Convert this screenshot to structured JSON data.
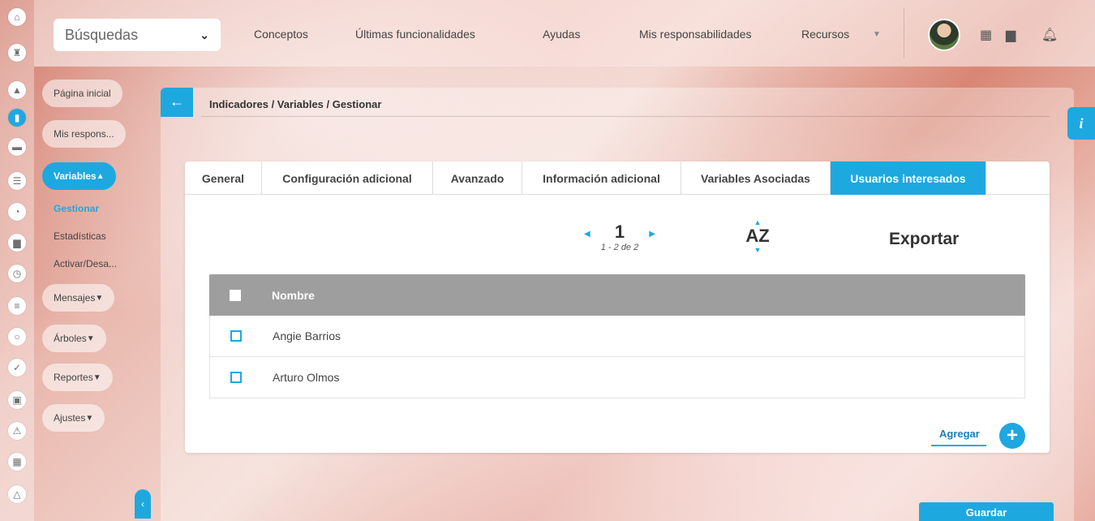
{
  "search": {
    "label": "Búsquedas"
  },
  "topnav": {
    "items": [
      "Conceptos",
      "Últimas funcionalidades",
      "Ayudas",
      "Mis responsabilidades",
      "Recursos"
    ]
  },
  "sidebar": {
    "home": "Página inicial",
    "responsibilities": "Mis respons...",
    "section": "Variables",
    "links": [
      "Gestionar",
      "Estadísticas",
      "Activar/Desa..."
    ],
    "groups": [
      "Mensajes",
      "Árboles",
      "Reportes",
      "Ajustes"
    ]
  },
  "breadcrumb": "Indicadores / Variables / Gestionar",
  "tabs": [
    "General",
    "Configuración adicional",
    "Avanzado",
    "Información adicional",
    "Variables Asociadas",
    "Usuarios interesados"
  ],
  "active_tab": "Usuarios interesados",
  "pager": {
    "page": "1",
    "range": "1 - 2 de 2"
  },
  "sort": {
    "label": "AZ"
  },
  "export_label": "Exportar",
  "table": {
    "header": "Nombre",
    "rows": [
      "Angie Barrios",
      "Arturo Olmos"
    ]
  },
  "actions": {
    "add": "Agregar",
    "save": "Guardar"
  },
  "colors": {
    "accent": "#1ea8e0",
    "header_gray": "#9e9e9e"
  }
}
